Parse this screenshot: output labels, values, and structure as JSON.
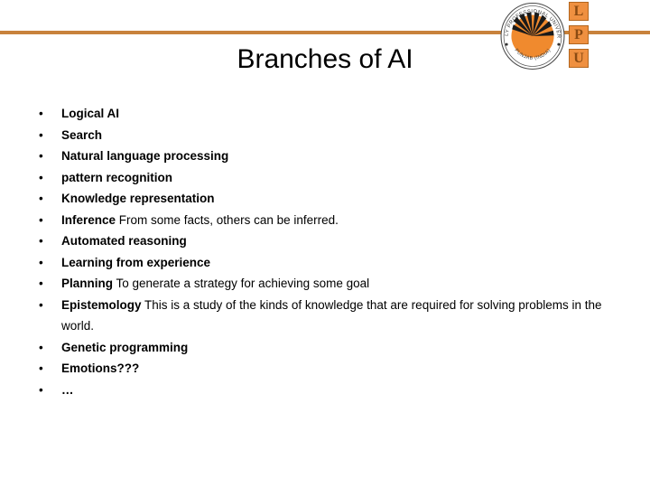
{
  "slide": {
    "title": "Branches of AI",
    "background_color": "#ffffff",
    "accent_color": "#c8823c"
  },
  "header": {
    "rule_color": "#c8823c",
    "logo": {
      "name": "lpu-logo",
      "seal_text_top": "LOVELY PROFESSIONAL UNIVERSITY",
      "seal_text_bottom": "PUNJAB (INDIA)",
      "letters": [
        "L",
        "P",
        "U"
      ],
      "letter_box_color": "#ef9040",
      "letter_color": "#8a4a12"
    }
  },
  "content": {
    "bullet_glyph": "•",
    "items": [
      {
        "strong": "Logical AI",
        "rest": ""
      },
      {
        "strong": "Search",
        "rest": ""
      },
      {
        "strong": "Natural language processing",
        "rest": ""
      },
      {
        "strong": "pattern recognition",
        "rest": ""
      },
      {
        "strong": "Knowledge representation",
        "rest": ""
      },
      {
        "strong": "Inference",
        "rest": " From some facts, others can be inferred."
      },
      {
        "strong": "Automated reasoning",
        "rest": ""
      },
      {
        "strong": "Learning from experience",
        "rest": ""
      },
      {
        "strong": "Planning",
        "rest": " To generate a strategy for achieving some goal"
      },
      {
        "strong": "Epistemology",
        "rest": " This is a study of the kinds of knowledge that are required for solving problems in the world."
      },
      {
        "strong": "Genetic programming",
        "rest": ""
      },
      {
        "strong": "Emotions???",
        "rest": ""
      },
      {
        "strong": "…",
        "rest": ""
      }
    ]
  }
}
